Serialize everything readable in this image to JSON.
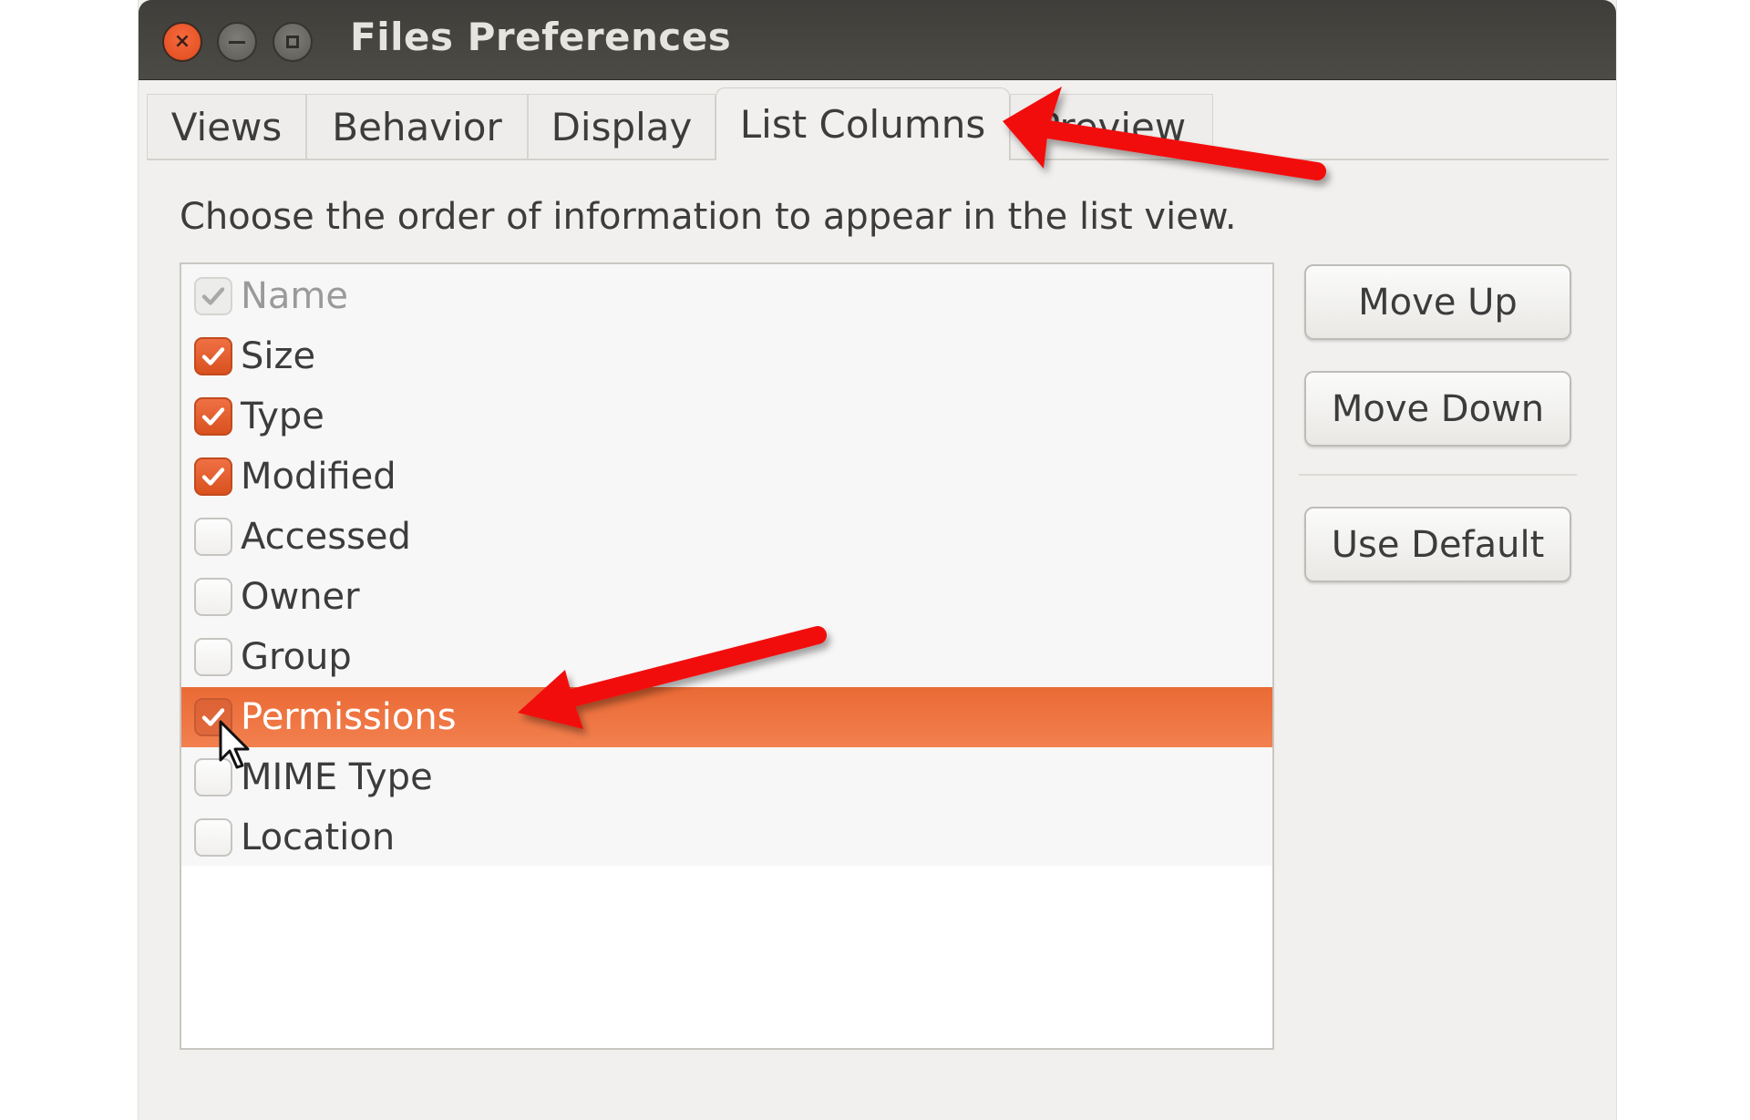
{
  "window": {
    "title": "Files Preferences",
    "controls": [
      "close",
      "minimize",
      "maximize"
    ]
  },
  "tabs": [
    {
      "label": "Views",
      "active": false
    },
    {
      "label": "Behavior",
      "active": false
    },
    {
      "label": "Display",
      "active": false
    },
    {
      "label": "List Columns",
      "active": true
    },
    {
      "label": "Preview",
      "active": false
    }
  ],
  "instruction": "Choose the order of information to appear in the list view.",
  "columns": [
    {
      "label": "Name",
      "checked": true,
      "disabled": true,
      "selected": false
    },
    {
      "label": "Size",
      "checked": true,
      "disabled": false,
      "selected": false
    },
    {
      "label": "Type",
      "checked": true,
      "disabled": false,
      "selected": false
    },
    {
      "label": "Modified",
      "checked": true,
      "disabled": false,
      "selected": false
    },
    {
      "label": "Accessed",
      "checked": false,
      "disabled": false,
      "selected": false
    },
    {
      "label": "Owner",
      "checked": false,
      "disabled": false,
      "selected": false
    },
    {
      "label": "Group",
      "checked": false,
      "disabled": false,
      "selected": false
    },
    {
      "label": "Permissions",
      "checked": true,
      "disabled": false,
      "selected": true
    },
    {
      "label": "MIME Type",
      "checked": false,
      "disabled": false,
      "selected": false
    },
    {
      "label": "Location",
      "checked": false,
      "disabled": false,
      "selected": false
    }
  ],
  "buttons": {
    "move_up": "Move Up",
    "move_down": "Move Down",
    "use_default": "Use Default"
  },
  "colors": {
    "accent": "#e95420",
    "selection": "#ef7540",
    "titlebar": "#45443f",
    "annotation_arrow": "#f20c0c"
  },
  "annotations": [
    {
      "type": "arrow",
      "points_to": "List Columns tab"
    },
    {
      "type": "arrow",
      "points_to": "Permissions row"
    }
  ]
}
